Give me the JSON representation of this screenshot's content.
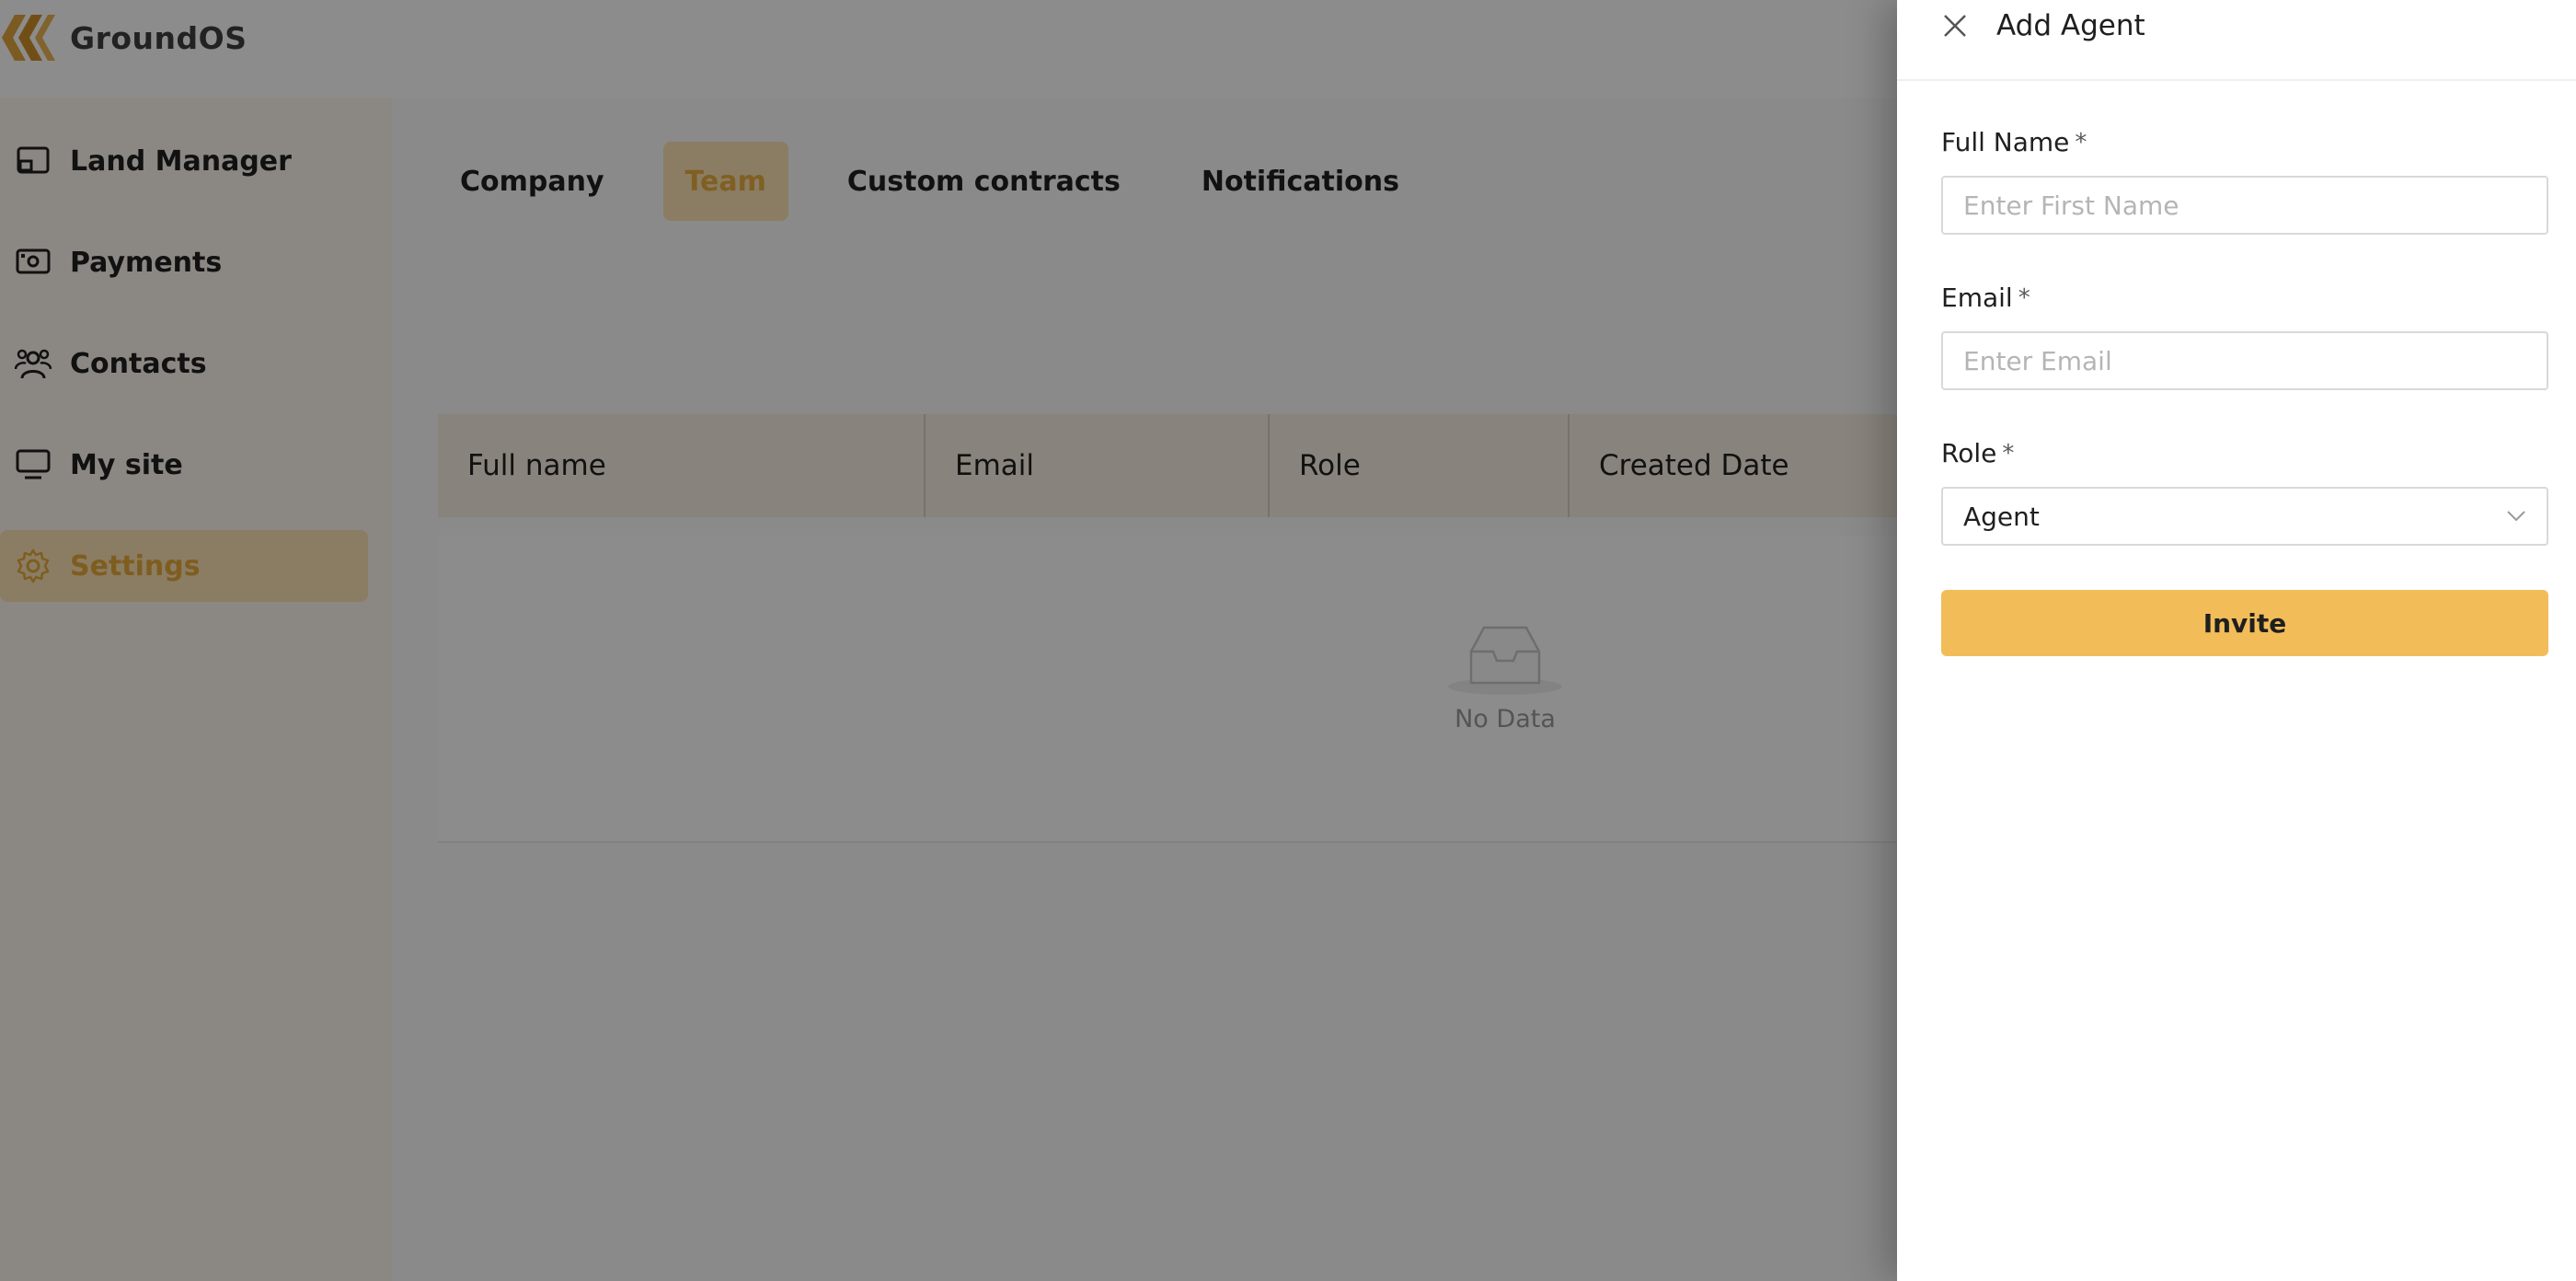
{
  "app": {
    "name": "GroundOS"
  },
  "sidebar": {
    "items": [
      {
        "label": "Land Manager",
        "icon": "land-manager-icon"
      },
      {
        "label": "Payments",
        "icon": "payments-icon"
      },
      {
        "label": "Contacts",
        "icon": "contacts-icon"
      },
      {
        "label": "My site",
        "icon": "monitor-icon"
      },
      {
        "label": "Settings",
        "icon": "gear-icon",
        "active": true
      }
    ]
  },
  "settings": {
    "tabs": [
      {
        "label": "Company"
      },
      {
        "label": "Team",
        "active": true
      },
      {
        "label": "Custom contracts"
      },
      {
        "label": "Notifications"
      }
    ],
    "table": {
      "columns": [
        "Full name",
        "Email",
        "Role",
        "Created Date"
      ],
      "rows": [],
      "empty_text": "No Data"
    }
  },
  "drawer": {
    "title": "Add Agent",
    "fields": {
      "full_name": {
        "label": "Full Name",
        "required_mark": "*",
        "placeholder": "Enter First Name",
        "value": ""
      },
      "email": {
        "label": "Email",
        "required_mark": "*",
        "placeholder": "Enter Email",
        "value": ""
      },
      "role": {
        "label": "Role",
        "required_mark": "*",
        "value": "Agent"
      }
    },
    "submit_label": "Invite"
  },
  "colors": {
    "accent": "#f2bd59",
    "accent_text": "#e7a93a",
    "active_bg": "#fbe3b4"
  }
}
